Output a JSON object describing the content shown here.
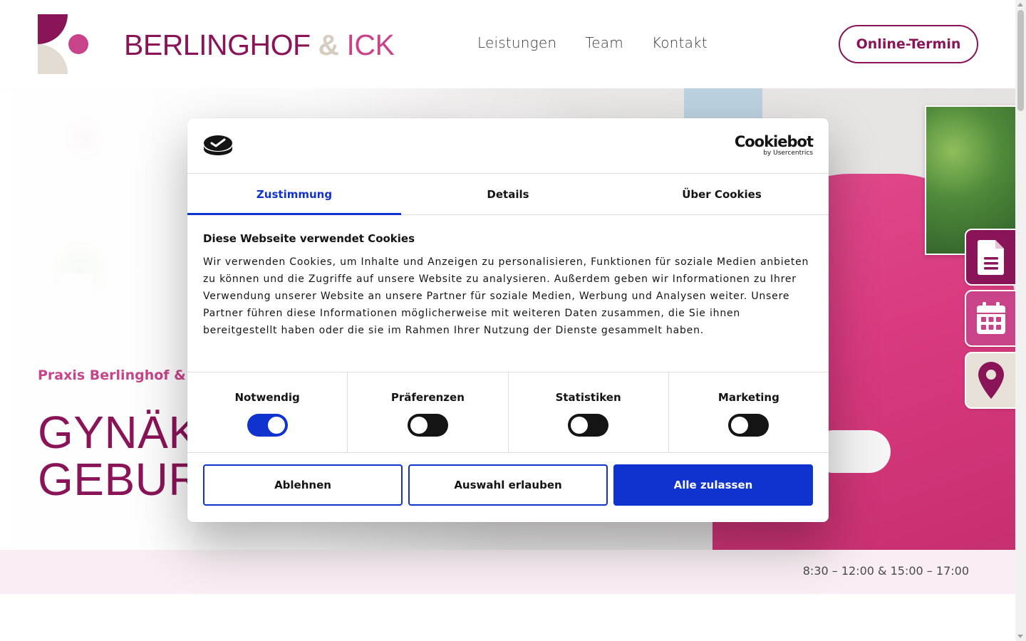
{
  "header": {
    "brand_main": "BERLINGHOF",
    "brand_amp": "&",
    "brand_second": "ICK",
    "nav": [
      {
        "label": "Leistungen"
      },
      {
        "label": "Team"
      },
      {
        "label": "Kontakt"
      }
    ],
    "cta_label": "Online-Termin"
  },
  "hero": {
    "subtitle": "Praxis Berlinghof & Ic",
    "title_line1": "GYNÄK",
    "title_line2": "GEBURT"
  },
  "side_tabs": [
    {
      "icon": "document-icon"
    },
    {
      "icon": "calendar-icon"
    },
    {
      "icon": "location-pin-icon"
    }
  ],
  "info_strip": {
    "hours": "8:30 – 12:00 & 15:00 – 17:00"
  },
  "cookie_dialog": {
    "provider": "Cookiebot",
    "provider_sub": "by Usercentrics",
    "tabs": [
      {
        "label": "Zustimmung",
        "active": true
      },
      {
        "label": "Details",
        "active": false
      },
      {
        "label": "Über Cookies",
        "active": false
      }
    ],
    "title": "Diese Webseite verwendet Cookies",
    "text": "Wir verwenden Cookies, um Inhalte und Anzeigen zu personalisieren, Funktionen für soziale Medien anbieten zu können und die Zugriffe auf unsere Website zu analysieren. Außerdem geben wir Informationen zu Ihrer Verwendung unserer Website an unsere Partner für soziale Medien, Werbung und Analysen weiter. Unsere Partner führen diese Informationen möglicherweise mit weiteren Daten zusammen, die Sie ihnen bereitgestellt haben oder die sie im Rahmen Ihrer Nutzung der Dienste gesammelt haben.",
    "toggles": [
      {
        "label": "Notwendig",
        "on": true
      },
      {
        "label": "Präferenzen",
        "on": false
      },
      {
        "label": "Statistiken",
        "on": false
      },
      {
        "label": "Marketing",
        "on": false
      }
    ],
    "buttons": {
      "decline": "Ablehnen",
      "allow_selection": "Auswahl erlauben",
      "allow_all": "Alle zulassen"
    }
  },
  "colors": {
    "brand_dark": "#8a1458",
    "brand_pink": "#c9438a",
    "brand_beige": "#d6ccbf",
    "cookiebot_blue": "#1032cf"
  }
}
